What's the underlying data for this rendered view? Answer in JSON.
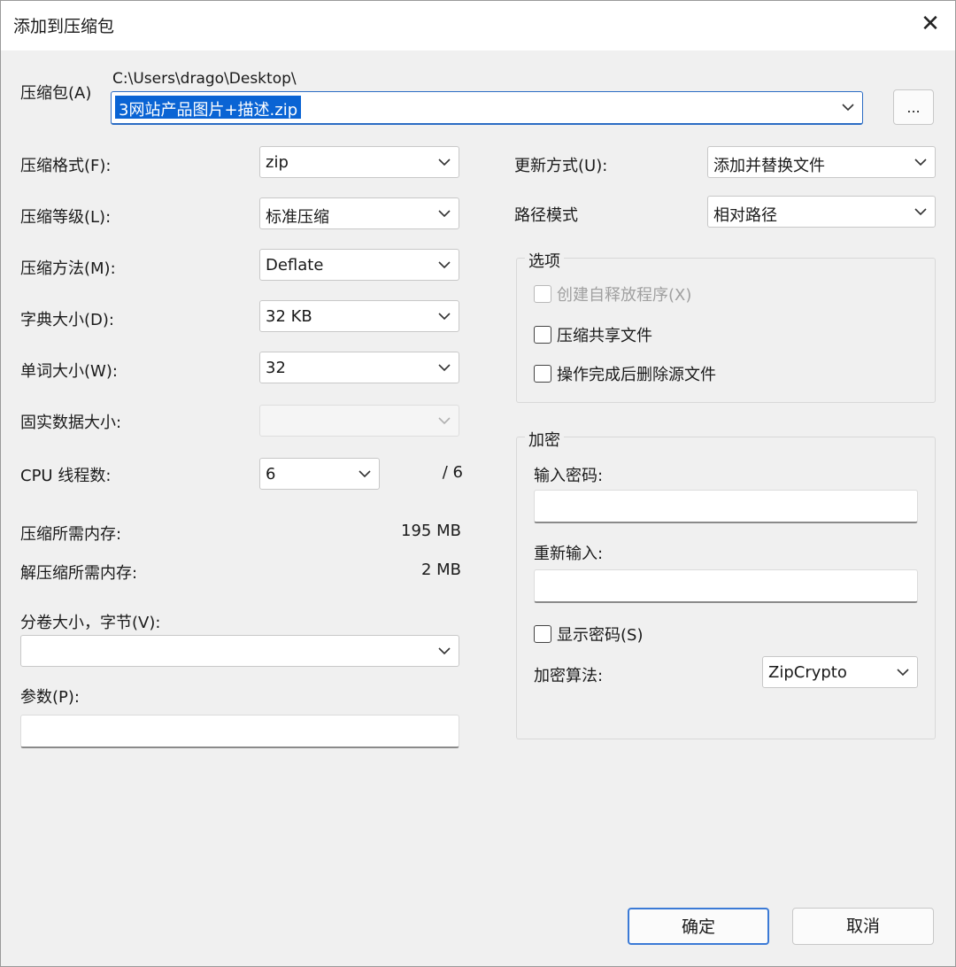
{
  "window": {
    "title": "添加到压缩包",
    "close_glyph": "✕"
  },
  "archive": {
    "label": "压缩包(A)",
    "path": "C:\\Users\\drago\\Desktop\\",
    "filename": "3网站产品图片+描述.zip",
    "browse_label": "..."
  },
  "left": {
    "format_label": "压缩格式(F):",
    "format_value": "zip",
    "level_label": "压缩等级(L):",
    "level_value": "标准压缩",
    "method_label": "压缩方法(M):",
    "method_value": "Deflate",
    "dict_label": "字典大小(D):",
    "dict_value": "32 KB",
    "word_label": "单词大小(W):",
    "word_value": "32",
    "solid_label": "固实数据大小:",
    "solid_value": "",
    "cpu_label": "CPU 线程数:",
    "cpu_value": "6",
    "cpu_max": "/ 6",
    "mem_compress_label": "压缩所需内存:",
    "mem_compress_value": "195 MB",
    "mem_decompress_label": "解压缩所需内存:",
    "mem_decompress_value": "2 MB",
    "volume_label": "分卷大小，字节(V):",
    "volume_value": "",
    "params_label": "参数(P):",
    "params_value": ""
  },
  "right": {
    "update_label": "更新方式(U):",
    "update_value": "添加并替换文件",
    "path_label": "路径模式",
    "path_value": "相对路径",
    "options": {
      "title": "选项",
      "sfx": "创建自释放程序(X)",
      "shared": "压缩共享文件",
      "delete_after": "操作完成后删除源文件"
    },
    "encryption": {
      "title": "加密",
      "password_label": "输入密码:",
      "password_value": "",
      "reenter_label": "重新输入:",
      "reenter_value": "",
      "show_password": "显示密码(S)",
      "method_label": "加密算法:",
      "method_value": "ZipCrypto"
    }
  },
  "buttons": {
    "ok": "确定",
    "cancel": "取消"
  },
  "icons": {
    "dropdown": "chevron-down-icon",
    "close": "close-icon"
  },
  "colors": {
    "selection": "#0a64d4",
    "default_button_border": "#3b7ad6"
  }
}
